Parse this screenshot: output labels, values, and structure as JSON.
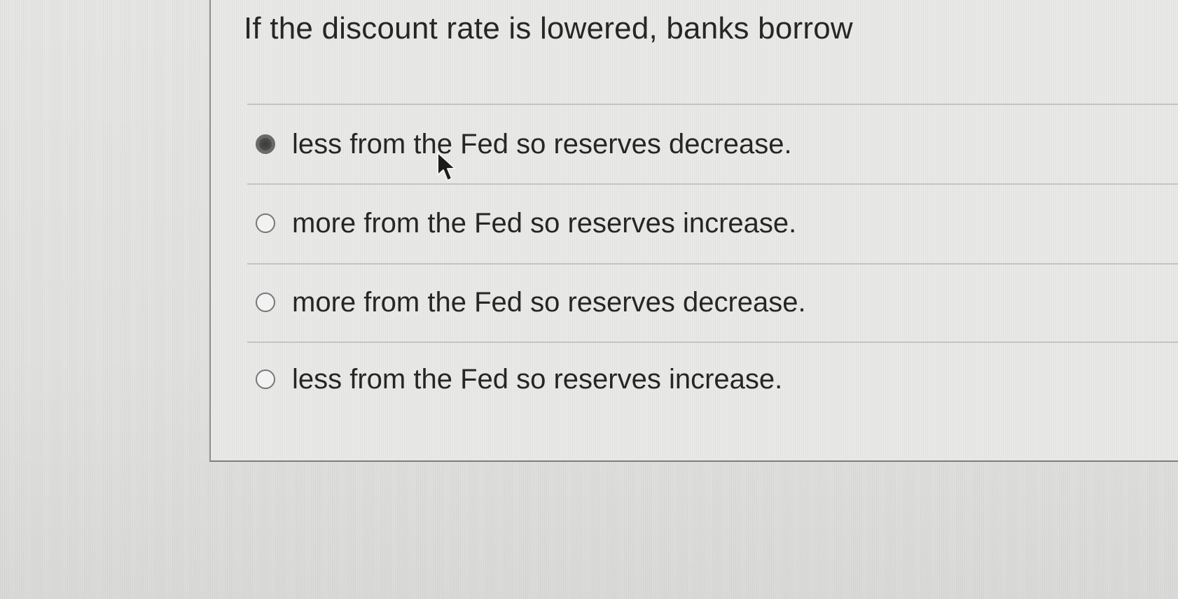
{
  "question": {
    "text": "If the discount rate is lowered, banks borrow"
  },
  "options": [
    {
      "label": "less from the Fed so reserves decrease.",
      "selected": true
    },
    {
      "label": "more from the Fed so reserves increase.",
      "selected": false
    },
    {
      "label": "more from the Fed so reserves decrease.",
      "selected": false
    },
    {
      "label": "less from the Fed so reserves increase.",
      "selected": false
    }
  ],
  "icons": {
    "radio": "radio-button-icon",
    "cursor": "mouse-pointer-icon"
  },
  "colors": {
    "text": "#262626",
    "radio_selected": "#4a4a4a",
    "divider": "#c4c4c2",
    "background": "#e6e6e4"
  }
}
